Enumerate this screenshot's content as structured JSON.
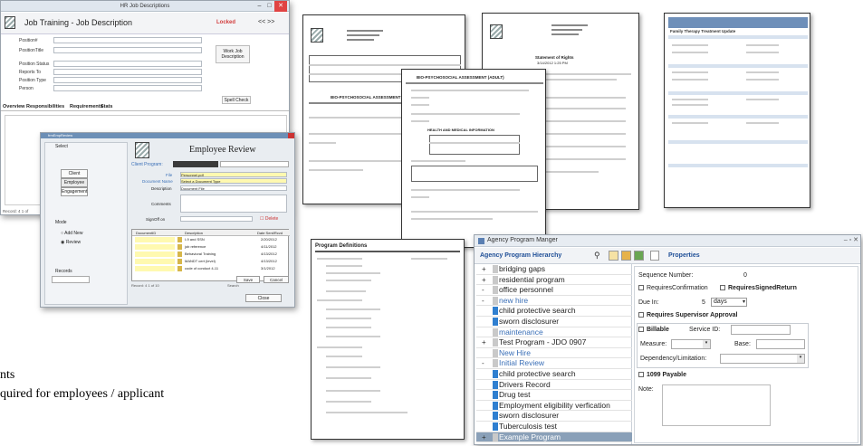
{
  "colors": {
    "titlebar": "#dfe6ee",
    "accent_blue": "#3a6fb7",
    "locked_red": "#d23d3d",
    "highlight_yellow": "#fff9b0",
    "tree_dark": "#8aa0b8"
  },
  "background_text": {
    "line1": "nts",
    "line2": "quired for employees / applicant"
  },
  "job_window": {
    "window_title": "HR Job Descriptions",
    "title": "Job Training - Job Description",
    "locked": "Locked",
    "nav": "<< >>",
    "fields": [
      "Position#",
      "PositionTitle",
      "Position Status",
      "Reports To",
      "Position Type",
      "Person"
    ],
    "work_button": "Work Job Description",
    "spell_button": "Spell Check",
    "tabs": [
      "Overview",
      "Responsibilities",
      "Requirements",
      "Stats"
    ],
    "record_nav": "Record: 4  1 of"
  },
  "employee_review": {
    "window_title": "frmEmpReview",
    "title": "Employee Review",
    "select_label": "Select",
    "buttons": [
      "Client",
      "Employee",
      "Engagement"
    ],
    "client_program_label": "Client Program:",
    "client_program_value": "",
    "file_label": "File",
    "file_value": "Personnel.pdf",
    "doc_name_label": "Document Name",
    "doc_name_value": "Select a Document Type",
    "description_label": "Description",
    "description_value": "Document File",
    "comments_label": "Comments",
    "signoff_label": "SignOff on",
    "delete_label": "Delete",
    "mode_label": "Mode",
    "add_new": "Add New",
    "review": "Review",
    "records_label": "Records",
    "table_headers": [
      "DocumentID",
      "Description",
      "Date Sent/Rcvd"
    ],
    "rows": [
      {
        "desc": "I-9 and SSN",
        "date": "2/20/2012"
      },
      {
        "desc": "job reference",
        "date": "4/11/2012"
      },
      {
        "desc": "Behavioral Training",
        "date": "4/13/2012"
      },
      {
        "desc": "MANDT cert (level)",
        "date": "4/13/2012"
      },
      {
        "desc": "code of conduct 4-11",
        "date": "3/1/2012"
      }
    ],
    "record_nav": "Record: 4  1 of 10",
    "search": "Search",
    "save": "Save",
    "cancel": "Cancel",
    "close": "Close"
  },
  "doc_assessment": {
    "header": "BIO-PSYCHOSOCIAL ASSESSMENT (ADULT)",
    "header2": "BIO-PSYCHOSOCIAL ASSESSMENT (ADULT)",
    "section": "HEALTH AND MEDICAL INFORMATION"
  },
  "doc_rights": {
    "title": "Statement of Rights",
    "subtitle": "3/14/2012 1:25 PM"
  },
  "doc_updates": {
    "title": "Family Therapy Treatment Update"
  },
  "doc_program": {
    "title": "Program Definitions"
  },
  "agency": {
    "window_title": "Agency Program Manger",
    "hierarchy_label": "Agency Program Hierarchy",
    "properties_label": "Properties",
    "tree": [
      {
        "pm": "+",
        "label": "bridging gaps",
        "chip": "#c9c9c9",
        "style": ""
      },
      {
        "pm": "+",
        "label": "residential program",
        "chip": "#c9c9c9",
        "style": ""
      },
      {
        "pm": "-",
        "label": "office personnel",
        "chip": "#c9c9c9",
        "style": ""
      },
      {
        "pm": "-",
        "label": "new hire",
        "chip": "#c9c9c9",
        "style": "blue"
      },
      {
        "pm": "",
        "label": "child protective search",
        "chip": "#2f7fd0",
        "style": ""
      },
      {
        "pm": "",
        "label": "sworn disclosurer",
        "chip": "#2f7fd0",
        "style": ""
      },
      {
        "pm": "",
        "label": "maintenance",
        "chip": "#c9c9c9",
        "style": "blue"
      },
      {
        "pm": "+",
        "label": "Test Program - JDO 0907",
        "chip": "#c9c9c9",
        "style": ""
      },
      {
        "pm": "",
        "label": "New Hire",
        "chip": "#c9c9c9",
        "style": "blue"
      },
      {
        "pm": "-",
        "label": "Initial Review",
        "chip": "#c9c9c9",
        "style": "blue"
      },
      {
        "pm": "",
        "label": "child protective search",
        "chip": "#2f7fd0",
        "style": ""
      },
      {
        "pm": "",
        "label": "Drivers Record",
        "chip": "#2f7fd0",
        "style": ""
      },
      {
        "pm": "",
        "label": "Drug test",
        "chip": "#2f7fd0",
        "style": ""
      },
      {
        "pm": "",
        "label": "Employment eligibility verfication",
        "chip": "#2f7fd0",
        "style": ""
      },
      {
        "pm": "",
        "label": "sworn disclosurer",
        "chip": "#2f7fd0",
        "style": ""
      },
      {
        "pm": "",
        "label": "Tuberculosis test",
        "chip": "#2f7fd0",
        "style": ""
      },
      {
        "pm": "+",
        "label": "Example Program",
        "chip": "#c9c9c9",
        "style": "dark"
      }
    ],
    "props": {
      "sequence_label": "Sequence Number:",
      "sequence_value": "0",
      "requires_confirmation": "RequiresConfirmation",
      "requires_signed_return": "RequiresSignedReturn",
      "due_in_label": "Due In:",
      "due_in_value": "5",
      "due_in_unit": "days",
      "supervisor": "Requires Supervisor Approval",
      "billable": "Billable",
      "service_id": "Service ID:",
      "measure": "Measure:",
      "base": "Base:",
      "dependency": "Dependency/Limitation:",
      "payable": "1099 Payable",
      "note": "Note:"
    }
  }
}
